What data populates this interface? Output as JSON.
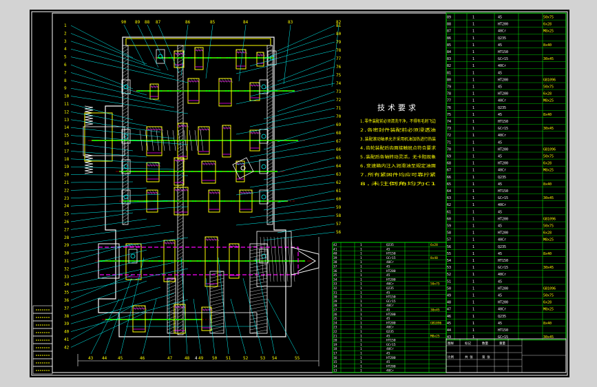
{
  "colors": {
    "background": "#000000",
    "frame": "#ffffff",
    "callout": "#00ffff",
    "text_yellow": "#ffff00",
    "text_green": "#00ff00",
    "outline_yellow": "#ffff00",
    "gear_magenta": "#ff00ff",
    "shaft_green": "#00ff00",
    "bom_grid": "#00ff00",
    "bom_text": "#ffffff",
    "hatch": "#ffffff"
  },
  "drawing": {
    "top_labels": [
      "90",
      "89",
      "88",
      "87",
      "86",
      "85",
      "84",
      "83",
      "82"
    ],
    "left_labels": [
      "1",
      "2",
      "3",
      "4",
      "5",
      "6",
      "7",
      "8",
      "9",
      "10",
      "11",
      "12",
      "13",
      "14",
      "15",
      "16",
      "17",
      "18",
      "19",
      "20",
      "21",
      "22",
      "23",
      "24",
      "25",
      "26",
      "27",
      "28",
      "29",
      "30",
      "31",
      "32",
      "33",
      "34",
      "35",
      "36",
      "37",
      "38",
      "39",
      "40",
      "41",
      "42"
    ],
    "right_labels": [
      "81",
      "80",
      "79",
      "78",
      "77",
      "76",
      "75",
      "74",
      "73",
      "72",
      "71",
      "70",
      "69",
      "68",
      "67",
      "66",
      "65",
      "64",
      "63",
      "62",
      "61",
      "60",
      "59",
      "58",
      "57",
      "56"
    ],
    "bottom_labels": [
      "43",
      "44",
      "45",
      "46",
      "47",
      "48",
      "49",
      "50",
      "51",
      "52",
      "53",
      "54",
      "55"
    ],
    "dimension_label": "4"
  },
  "tech_requirements": {
    "title": "技术要求",
    "lines": [
      "1.零件装配前必须清洗干净，不得有毛刺飞边",
      "2.各密封件装配前必须浸透油",
      "3.装配滚动轴承允许采用机油加热进行热装",
      "4.齿轮装配后齿面接触斑点符合要求",
      "5.装配后各轴转动灵活，无卡阻现象",
      "6.变速箱内注入润滑油至规定油面",
      "7.所有紧固件均应可靠拧紧",
      "8.未注倒角均为C1"
    ]
  },
  "bom_right": {
    "row_count": 47,
    "first_no": 89,
    "mats": [
      "45",
      "HT200",
      "40Cr",
      "Q235",
      "45",
      "HT150",
      "GCr15",
      "40Cr",
      "45",
      "HT200"
    ],
    "specs": [
      "50x75",
      "6x28",
      "M8x25",
      "",
      "8x40",
      "",
      "30x45",
      "",
      "",
      "GB1096"
    ]
  },
  "bom_bottom": {
    "row_count": 30,
    "first_no": 42
  },
  "title_block": {
    "cells": [
      "图样",
      "标记",
      "数量",
      "重量",
      "比例",
      "共 张",
      "第 张"
    ]
  },
  "legend_left": {
    "rows": [
      "",
      "",
      "",
      "",
      "",
      "",
      "",
      "",
      ""
    ]
  }
}
